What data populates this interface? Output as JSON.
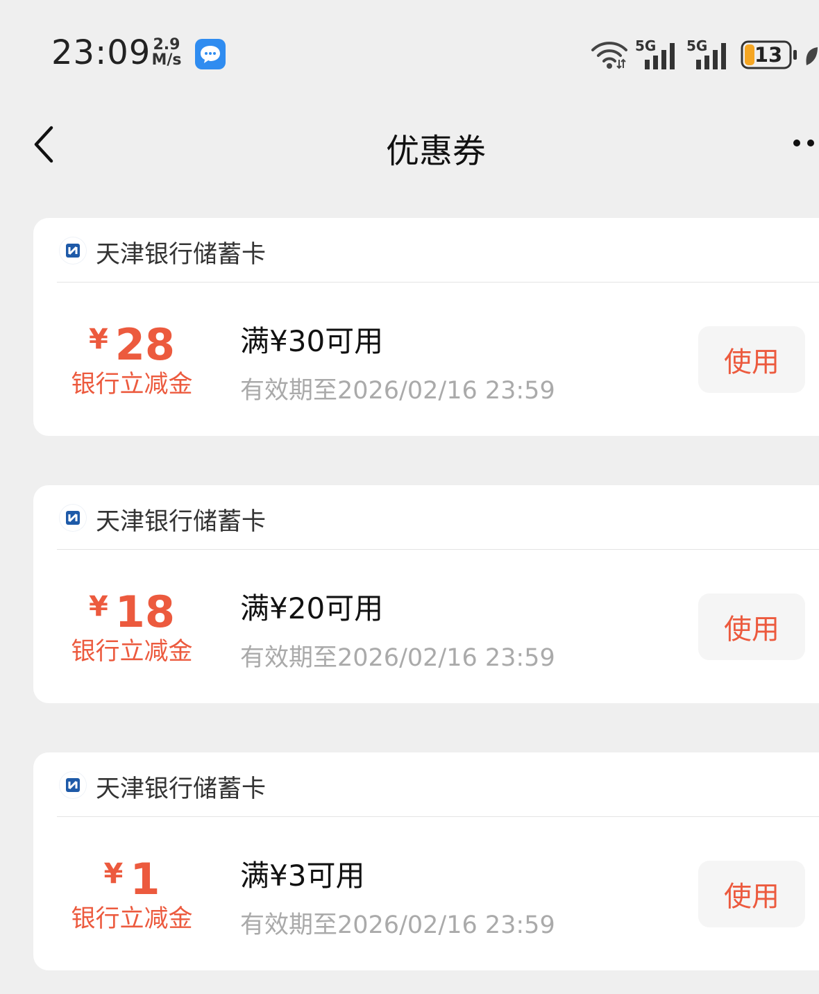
{
  "status_bar": {
    "time": "23:09",
    "net_speed_value": "2.9",
    "net_speed_unit": "M/s",
    "battery_level": "13",
    "network_label_1": "5G",
    "network_label_2": "5G",
    "accent_battery": "#f5a623"
  },
  "header": {
    "title": "优惠券",
    "back_icon": "chevron-left-icon",
    "more_icon": "more-dots-icon"
  },
  "colors": {
    "accent": "#ec5a3e",
    "background": "#efefef",
    "card": "#ffffff",
    "bank_logo": "#1e5aa8"
  },
  "coupons": [
    {
      "bank": "天津银行储蓄卡",
      "currency": "¥",
      "amount": "28",
      "type": "银行立减金",
      "condition": "满¥30可用",
      "expiry": "有效期至2026/02/16 23:59",
      "button": "使用"
    },
    {
      "bank": "天津银行储蓄卡",
      "currency": "¥",
      "amount": "18",
      "type": "银行立减金",
      "condition": "满¥20可用",
      "expiry": "有效期至2026/02/16 23:59",
      "button": "使用"
    },
    {
      "bank": "天津银行储蓄卡",
      "currency": "¥",
      "amount": "1",
      "type": "银行立减金",
      "condition": "满¥3可用",
      "expiry": "有效期至2026/02/16 23:59",
      "button": "使用"
    }
  ]
}
